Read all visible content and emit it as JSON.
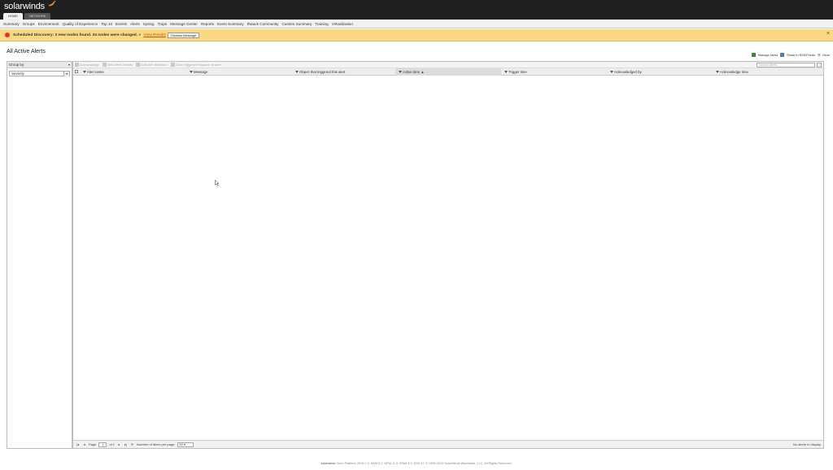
{
  "app": {
    "logo_text": "solarwinds",
    "tabs": [
      {
        "label": "HOME",
        "active": true
      },
      {
        "label": "NETWORK",
        "active": false
      }
    ]
  },
  "nav": {
    "items": [
      "Summary",
      "Groups",
      "Environment",
      "Quality of Experience",
      "Top 10",
      "Events",
      "Alerts",
      "Syslog",
      "Traps",
      "Message Center",
      "Reports",
      "Event Summary",
      "thwack Community",
      "Custom Summary",
      "Training",
      "Virtualization"
    ]
  },
  "banner": {
    "text": "Scheduled Discovery: 3 new nodes found. 34 nodes were changed. »",
    "link": "View Results",
    "dismiss": "Dismiss Message",
    "close": "×",
    "color": "#fbd982"
  },
  "page": {
    "title": "All Active Alerts",
    "actions": {
      "manage": "Manage Alerts",
      "export": "Share to RSS/Feeds",
      "menu": "☰",
      "more": "More"
    }
  },
  "left_panel": {
    "group_by_label": "Group by:",
    "group_by_value": "Severity"
  },
  "grid": {
    "toolbar": [
      "Acknowledge",
      "View Alert Details",
      "Edit alert definition",
      "Clear triggered instance of alert"
    ],
    "search_placeholder": "Search alerts",
    "columns": [
      {
        "label": "Alert name",
        "sorted": false
      },
      {
        "label": "Message",
        "sorted": false
      },
      {
        "label": "Object that triggered this alert",
        "sorted": false
      },
      {
        "label": "Active time ▲",
        "sorted": true
      },
      {
        "label": "Trigger time",
        "sorted": false
      },
      {
        "label": "Acknowledged by",
        "sorted": false
      },
      {
        "label": "Acknowledge time",
        "sorted": false
      }
    ],
    "pager": {
      "page_label": "Page",
      "page_value": "1",
      "of_label": "of 1",
      "per_page_label": "Number of items per page:",
      "per_page_value": "50",
      "status": "No alerts to display"
    }
  },
  "footer": {
    "brand": "solarwinds",
    "text": "Orion Platform 2015.1.0, SAM 6.2, NPM 11.5, IPAM 4.3, NTA 4.1 © 1999-2015 SolarWinds Worldwide, LLC. All Rights Reserved."
  }
}
